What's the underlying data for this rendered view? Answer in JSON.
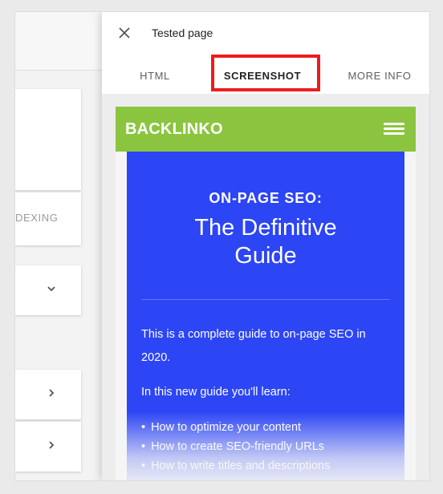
{
  "background_app": {
    "indexing_label": "DEXING"
  },
  "panel": {
    "title": "Tested page",
    "tabs": [
      {
        "label": "HTML"
      },
      {
        "label": "SCREENSHOT",
        "active": true
      },
      {
        "label": "MORE INFO"
      }
    ]
  },
  "screenshot": {
    "logo": "BACKLINKO",
    "kicker": "ON-PAGE SEO:",
    "title_line1": "The Definitive",
    "title_line2": "Guide",
    "intro": "This is a complete guide to on-page SEO in 2020.",
    "learn_intro": "In this new guide you'll learn:",
    "bullets": [
      "How to optimize your content",
      "How to create SEO-friendly URLs",
      "How to write titles and descriptions"
    ]
  },
  "colors": {
    "header_green": "#8bc53f",
    "card_blue": "#2c45f5",
    "highlight_red": "#ee1c1c"
  },
  "icons": {
    "close": "close-icon",
    "menu": "hamburger-menu-icon",
    "chevron_down": "chevron-down-icon",
    "chevron_right": "chevron-right-icon"
  }
}
